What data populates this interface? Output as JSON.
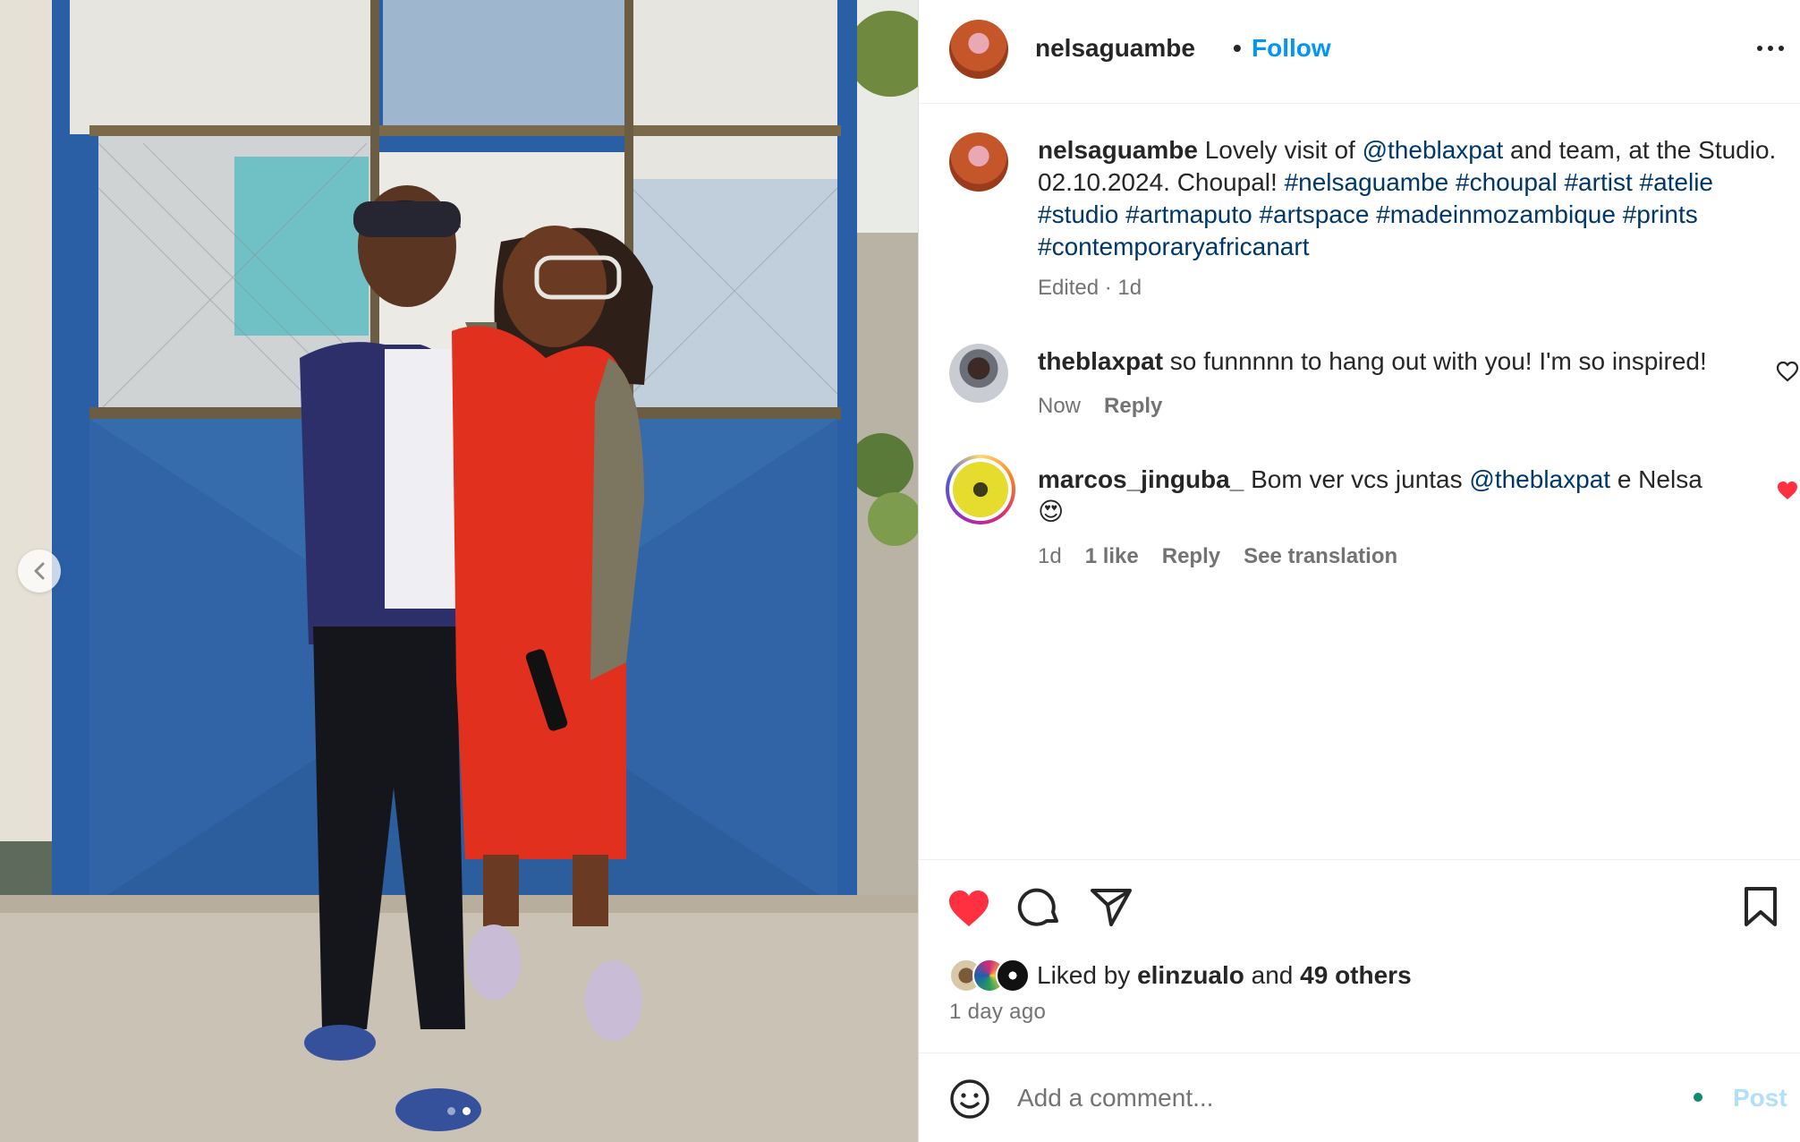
{
  "media": {
    "alt_icon": "chevron-left-icon",
    "carousel": {
      "count": 2,
      "active_index": 0
    }
  },
  "header": {
    "username": "nelsaguambe",
    "separator": "•",
    "follow_label": "Follow",
    "more_icon": "more-horizontal-icon"
  },
  "caption": {
    "username": "nelsaguambe",
    "text_1": " Lovely visit of ",
    "mention": "@theblaxpat",
    "text_2": " and team, at the Studio. 02.10.2024. Choupal! ",
    "hashtags": "#nelsaguambe #choupal #artist #atelie #studio #artmaputo #artspace #madeinmozambique #prints #contemporaryafricanart",
    "meta": "Edited · 1d"
  },
  "comments": [
    {
      "username": "theblaxpat",
      "text": " so funnnnn to hang out with you! I'm so inspired!",
      "time": "Now",
      "reply_label": "Reply",
      "liked": false
    },
    {
      "username": "marcos_jinguba_",
      "text_1": " Bom ver vcs juntas ",
      "mention": "@theblaxpat",
      "text_2": " e Nelsa",
      "emoji": "😍",
      "time": "1d",
      "likes": "1 like",
      "reply_label": "Reply",
      "translate_label": "See translation",
      "liked": true
    }
  ],
  "actions": {
    "like_icon": "heart-filled-icon",
    "comment_icon": "comment-icon",
    "share_icon": "send-icon",
    "save_icon": "bookmark-icon",
    "liked_by_prefix": "Liked by ",
    "liked_by_user": "elinzualo",
    "liked_by_and": " and ",
    "liked_by_others": "49 others",
    "time_ago": "1 day ago"
  },
  "comment_bar": {
    "placeholder": "Add a comment...",
    "post_label": "Post",
    "emoji_icon": "smiley-icon"
  },
  "colors": {
    "accent": "#0095f6",
    "like": "#ff3040",
    "link": "#00376b",
    "secondary_text": "#737373"
  }
}
